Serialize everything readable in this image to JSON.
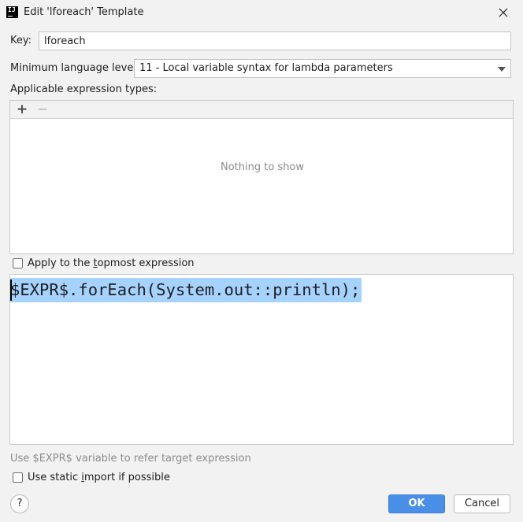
{
  "dialog": {
    "title": "Edit 'lforeach' Template",
    "app_icon_text": "IJ",
    "close_icon": "close-icon"
  },
  "key": {
    "label": "Key:",
    "value": "lforeach"
  },
  "language_level": {
    "label": "Minimum language level:",
    "selected": "11 - Local variable syntax for lambda parameters"
  },
  "expression_types": {
    "label": "Applicable expression types:",
    "add_label": "+",
    "remove_label": "−",
    "empty_text": "Nothing to show"
  },
  "topmost": {
    "label": "Apply to the topmost expression",
    "checked": false
  },
  "editor": {
    "code": "$EXPR$.forEach(System.out::println);",
    "selection_color": "#a6d2ff"
  },
  "hint": "Use $EXPR$ variable to refer target expression",
  "static_import": {
    "label": "Use static import if possible",
    "checked": false
  },
  "footer": {
    "help_label": "?",
    "ok_label": "OK",
    "cancel_label": "Cancel",
    "accent_color": "#4a8fe7"
  }
}
